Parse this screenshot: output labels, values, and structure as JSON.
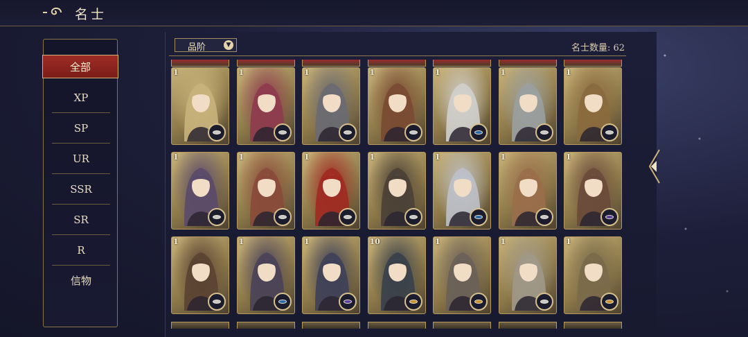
{
  "header": {
    "title": "名士"
  },
  "sidebar": {
    "items": [
      {
        "label": "全部",
        "active": true
      },
      {
        "label": "XP"
      },
      {
        "label": "SP"
      },
      {
        "label": "UR"
      },
      {
        "label": "SSR"
      },
      {
        "label": "SR"
      },
      {
        "label": "R"
      },
      {
        "label": "信物"
      }
    ]
  },
  "filter": {
    "label": "品阶"
  },
  "count": {
    "text": "名士数量: 62"
  },
  "cards": [
    {
      "level": "1",
      "badge": "silver",
      "tint": "#c8b27c"
    },
    {
      "level": "1",
      "badge": "silver",
      "tint": "#8e3b4e"
    },
    {
      "level": "1",
      "badge": "silver",
      "tint": "#6a6a72"
    },
    {
      "level": "1",
      "badge": "silver",
      "tint": "#7a4a32"
    },
    {
      "level": "1",
      "badge": "blue",
      "tint": "#d0cfcc"
    },
    {
      "level": "1",
      "badge": "silver",
      "tint": "#9aa0a0"
    },
    {
      "level": "1",
      "badge": "silver",
      "tint": "#8a6a3e"
    },
    {
      "level": "1",
      "badge": "silver",
      "tint": "#5a4a6a"
    },
    {
      "level": "1",
      "badge": "silver",
      "tint": "#8a4a3a"
    },
    {
      "level": "1",
      "badge": "silver",
      "tint": "#a02a22"
    },
    {
      "level": "1",
      "badge": "silver",
      "tint": "#4a4036"
    },
    {
      "level": "1",
      "badge": "blue",
      "tint": "#bcc0c8"
    },
    {
      "level": "1",
      "badge": "silver",
      "tint": "#9a6e4a"
    },
    {
      "level": "1",
      "badge": "purple",
      "tint": "#6a4a3a"
    },
    {
      "level": "1",
      "badge": "silver",
      "tint": "#5a4232"
    },
    {
      "level": "1",
      "badge": "blue",
      "tint": "#4a4258"
    },
    {
      "level": "1",
      "badge": "purple",
      "tint": "#3e4058"
    },
    {
      "level": "10",
      "badge": "gold",
      "tint": "#38404a"
    },
    {
      "level": "1",
      "badge": "gold",
      "tint": "#6a6058"
    },
    {
      "level": "1",
      "badge": "silver",
      "tint": "#a09888"
    },
    {
      "level": "1",
      "badge": "gold",
      "tint": "#7a6a4a"
    }
  ],
  "colors": {
    "accent": "#9e2c25",
    "gold": "#b79a5e",
    "silver": "#c9c9c9",
    "blue": "#2a6aa8",
    "purple": "#5b3f9c",
    "goldBadge": "#c8902e"
  }
}
